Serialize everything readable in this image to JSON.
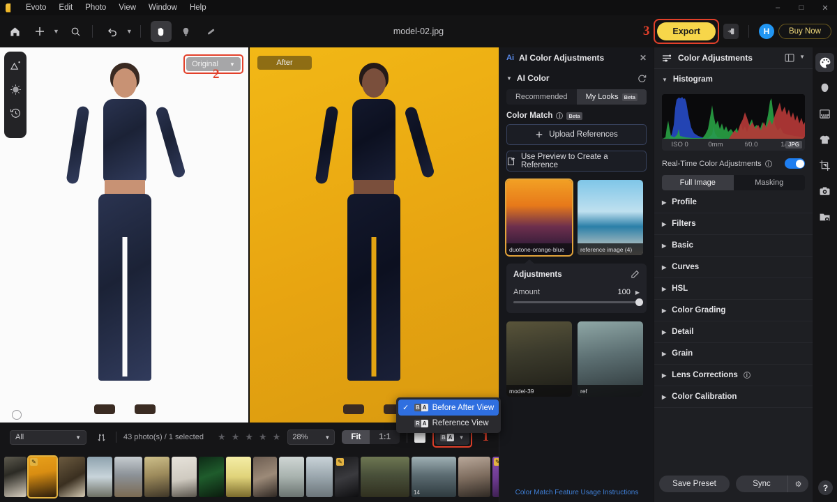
{
  "titlebar": {
    "app_name": "Evoto",
    "menus": [
      "Edit",
      "Photo",
      "View",
      "Window",
      "Help"
    ],
    "window_controls": [
      "minimize",
      "maximize",
      "close"
    ]
  },
  "toolbar": {
    "icons": [
      "home-icon",
      "add-icon",
      "search-icon",
      "undo-icon",
      "hand-icon",
      "dodge-icon",
      "heal-icon"
    ],
    "document_title": "model-02.jpg",
    "step_label_export": "3",
    "export_label": "Export",
    "export_side_icon": "export-to-icon",
    "avatar_initial": "H",
    "buy_label": "Buy Now"
  },
  "left_rail": {
    "items": [
      "retouch-magic-icon",
      "texture-icon",
      "history-icon"
    ]
  },
  "canvas": {
    "before_chip_label": "Original",
    "after_chip_label": "After",
    "step_label_original": "2",
    "loupe_icon": "loupe-icon"
  },
  "context_menu": {
    "items": [
      {
        "label": "Before After View",
        "selected": true,
        "glyph_a": "B",
        "glyph_b": "A"
      },
      {
        "label": "Reference View",
        "selected": false,
        "glyph_a": "R",
        "glyph_b": "A"
      }
    ]
  },
  "bottom_bar": {
    "filter_value": "All",
    "sort_icon": "sort-icon",
    "photo_count": "43 photo(s) / 1 selected",
    "star_count": 5,
    "zoom_value": "28%",
    "fit_label": "Fit",
    "one_to_one_label": "1:1",
    "white_swatch": "background-color-swatch",
    "view_mode_glyph_a": "B",
    "view_mode_glyph_b": "A",
    "step_label_view": "1"
  },
  "filmstrip": {
    "thumbs": [
      {
        "w": 32,
        "bg": "linear-gradient(160deg,#5d5a4e 0%,#2b2a24 40%,#d8cfc0 100%)",
        "sel": false,
        "badge": "",
        "num": ""
      },
      {
        "w": 40,
        "bg": "linear-gradient(170deg,#e8a01a 0%,#d98e12 40%,#2a1c0c 100%)",
        "sel": true,
        "badge": "edit",
        "num": ""
      },
      {
        "w": 38,
        "bg": "linear-gradient(150deg,#6b5a3f 0%,#3a2f20 55%,#d6cbb4 100%)",
        "sel": false,
        "badge": "",
        "num": ""
      },
      {
        "w": 36,
        "bg": "linear-gradient(180deg,#8ea2ae 0%,#c8d4da 50%,#6d6f63 100%)",
        "sel": false,
        "badge": "",
        "num": ""
      },
      {
        "w": 40,
        "bg": "linear-gradient(180deg,#c6ccd0 0%,#8c9298 45%,#7b6a52 100%)",
        "sel": false,
        "badge": "",
        "num": ""
      },
      {
        "w": 36,
        "bg": "linear-gradient(170deg,#cdbf8a 0%,#9d8b5c 45%,#3e3527 100%)",
        "sel": false,
        "badge": "",
        "num": ""
      },
      {
        "w": 36,
        "bg": "linear-gradient(170deg,#e6e2da 0%,#cfcac0 55%,#59544c 100%)",
        "sel": false,
        "badge": "",
        "num": ""
      },
      {
        "w": 36,
        "bg": "linear-gradient(160deg,#0d2a16 0%,#1f5c2c 45%,#0a1a0d 100%)",
        "sel": false,
        "badge": "",
        "num": ""
      },
      {
        "w": 36,
        "bg": "linear-gradient(180deg,#f4eda6 0%,#e0d37a 50%,#7a6a2c 100%)",
        "sel": false,
        "badge": "",
        "num": ""
      },
      {
        "w": 34,
        "bg": "linear-gradient(160deg,#6e5e52 0%,#9c8a78 50%,#2e2722 100%)",
        "sel": false,
        "badge": "",
        "num": ""
      },
      {
        "w": 36,
        "bg": "linear-gradient(180deg,#cfd6d4 0%,#a8b2ae 50%,#6a7370 100%)",
        "sel": false,
        "badge": "",
        "num": ""
      },
      {
        "w": 38,
        "bg": "linear-gradient(180deg,#c9d3d8 0%,#9aa6ad 50%,#6b7479 100%)",
        "sel": false,
        "badge": "",
        "num": ""
      },
      {
        "w": 34,
        "bg": "linear-gradient(160deg,#1a1a1c 0%,#3a3a3e 50%,#0e0e10 100%)",
        "sel": false,
        "badge": "edit",
        "num": ""
      },
      {
        "w": 70,
        "bg": "linear-gradient(180deg,#6e7752 0%,#49503a 45%,#30301f 100%)",
        "sel": false,
        "badge": "",
        "num": ""
      },
      {
        "w": 64,
        "bg": "linear-gradient(180deg,#9fb0b4 0%,#5c6c72 45%,#2f3a3f 100%)",
        "sel": false,
        "badge": "",
        "num": "14"
      },
      {
        "w": 46,
        "bg": "linear-gradient(170deg,#b9a89a 0%,#7d6c5e 50%,#2e2823 100%)",
        "sel": false,
        "badge": "",
        "num": ""
      },
      {
        "w": 52,
        "bg": "linear-gradient(165deg,#8a4fb0 0%,#6d3a90 45%,#2a1638 100%)",
        "sel": false,
        "badge": "edit",
        "num": ""
      }
    ]
  },
  "ai_panel": {
    "badge": "Ai",
    "title": "AI Color Adjustments",
    "close_icon": "close-icon",
    "section_title": "AI Color",
    "reset_icon": "reset-icon",
    "tabs": [
      {
        "label": "Recommended",
        "active": false,
        "beta": ""
      },
      {
        "label": "My Looks",
        "active": true,
        "beta": "Beta"
      }
    ],
    "color_match_label": "Color Match",
    "color_match_beta": "Beta",
    "upload_label": "Upload References",
    "upload_icon": "plus-icon",
    "preview_ref_label": "Use Preview to Create a Reference",
    "preview_ref_icon": "upload-file-icon",
    "references": [
      {
        "label": "duotone-orange-blue",
        "selected": true,
        "style": "ref-img1"
      },
      {
        "label": "reference image (4)",
        "selected": false,
        "style": "ref-img2"
      },
      {
        "label": "model-39",
        "selected": false,
        "style": "ref-img3"
      },
      {
        "label": "ref",
        "selected": false,
        "style": "ref-img4"
      }
    ],
    "adjustments": {
      "title": "Adjustments",
      "edit_icon": "edit-pencil-icon",
      "amount_label": "Amount",
      "amount_value": "100",
      "amount_percent": 100
    },
    "footer_link": "Color Match Feature Usage Instructions"
  },
  "color_panel": {
    "title": "Color Adjustments",
    "title_icon": "sliders-icon",
    "layout_icon": "split-layout-icon",
    "chevron_icon": "chevron-down-icon",
    "histogram_section": "Histogram",
    "histogram_meta": [
      "ISO 0",
      "0mm",
      "f/0.0",
      "1/0s"
    ],
    "histogram_format": "JPG",
    "realtime_label": "Real-Time Color Adjustments",
    "realtime_on": true,
    "mode_tabs": [
      {
        "label": "Full Image",
        "active": true
      },
      {
        "label": "Masking",
        "active": false
      }
    ],
    "sections": [
      {
        "label": "Profile",
        "info": false
      },
      {
        "label": "Filters",
        "info": false
      },
      {
        "label": "Basic",
        "info": false
      },
      {
        "label": "Curves",
        "info": false
      },
      {
        "label": "HSL",
        "info": false
      },
      {
        "label": "Color Grading",
        "info": false
      },
      {
        "label": "Detail",
        "info": false
      },
      {
        "label": "Grain",
        "info": false
      },
      {
        "label": "Lens Corrections",
        "info": true
      },
      {
        "label": "Color Calibration",
        "info": false
      }
    ],
    "save_preset_label": "Save Preset",
    "sync_label": "Sync",
    "sync_settings_icon": "gear-icon"
  },
  "right_rail": {
    "items": [
      {
        "icon": "palette-icon",
        "active": true
      },
      {
        "icon": "face-retouch-icon",
        "active": false
      },
      {
        "icon": "background-icon",
        "active": false
      },
      {
        "icon": "clothing-icon",
        "active": false
      },
      {
        "icon": "crop-icon",
        "active": false
      },
      {
        "icon": "camera-icon",
        "active": false
      },
      {
        "icon": "folder-icon",
        "active": false
      }
    ],
    "help_label": "?"
  },
  "colors": {
    "accent_yellow": "#f7d64a",
    "accent_red": "#e2402a",
    "accent_blue": "#2f6fe0",
    "toggle_blue": "#1e7ef0",
    "link_blue": "#3f7fd6",
    "panel_bg": "#1e1f23",
    "app_bg": "#131314"
  }
}
